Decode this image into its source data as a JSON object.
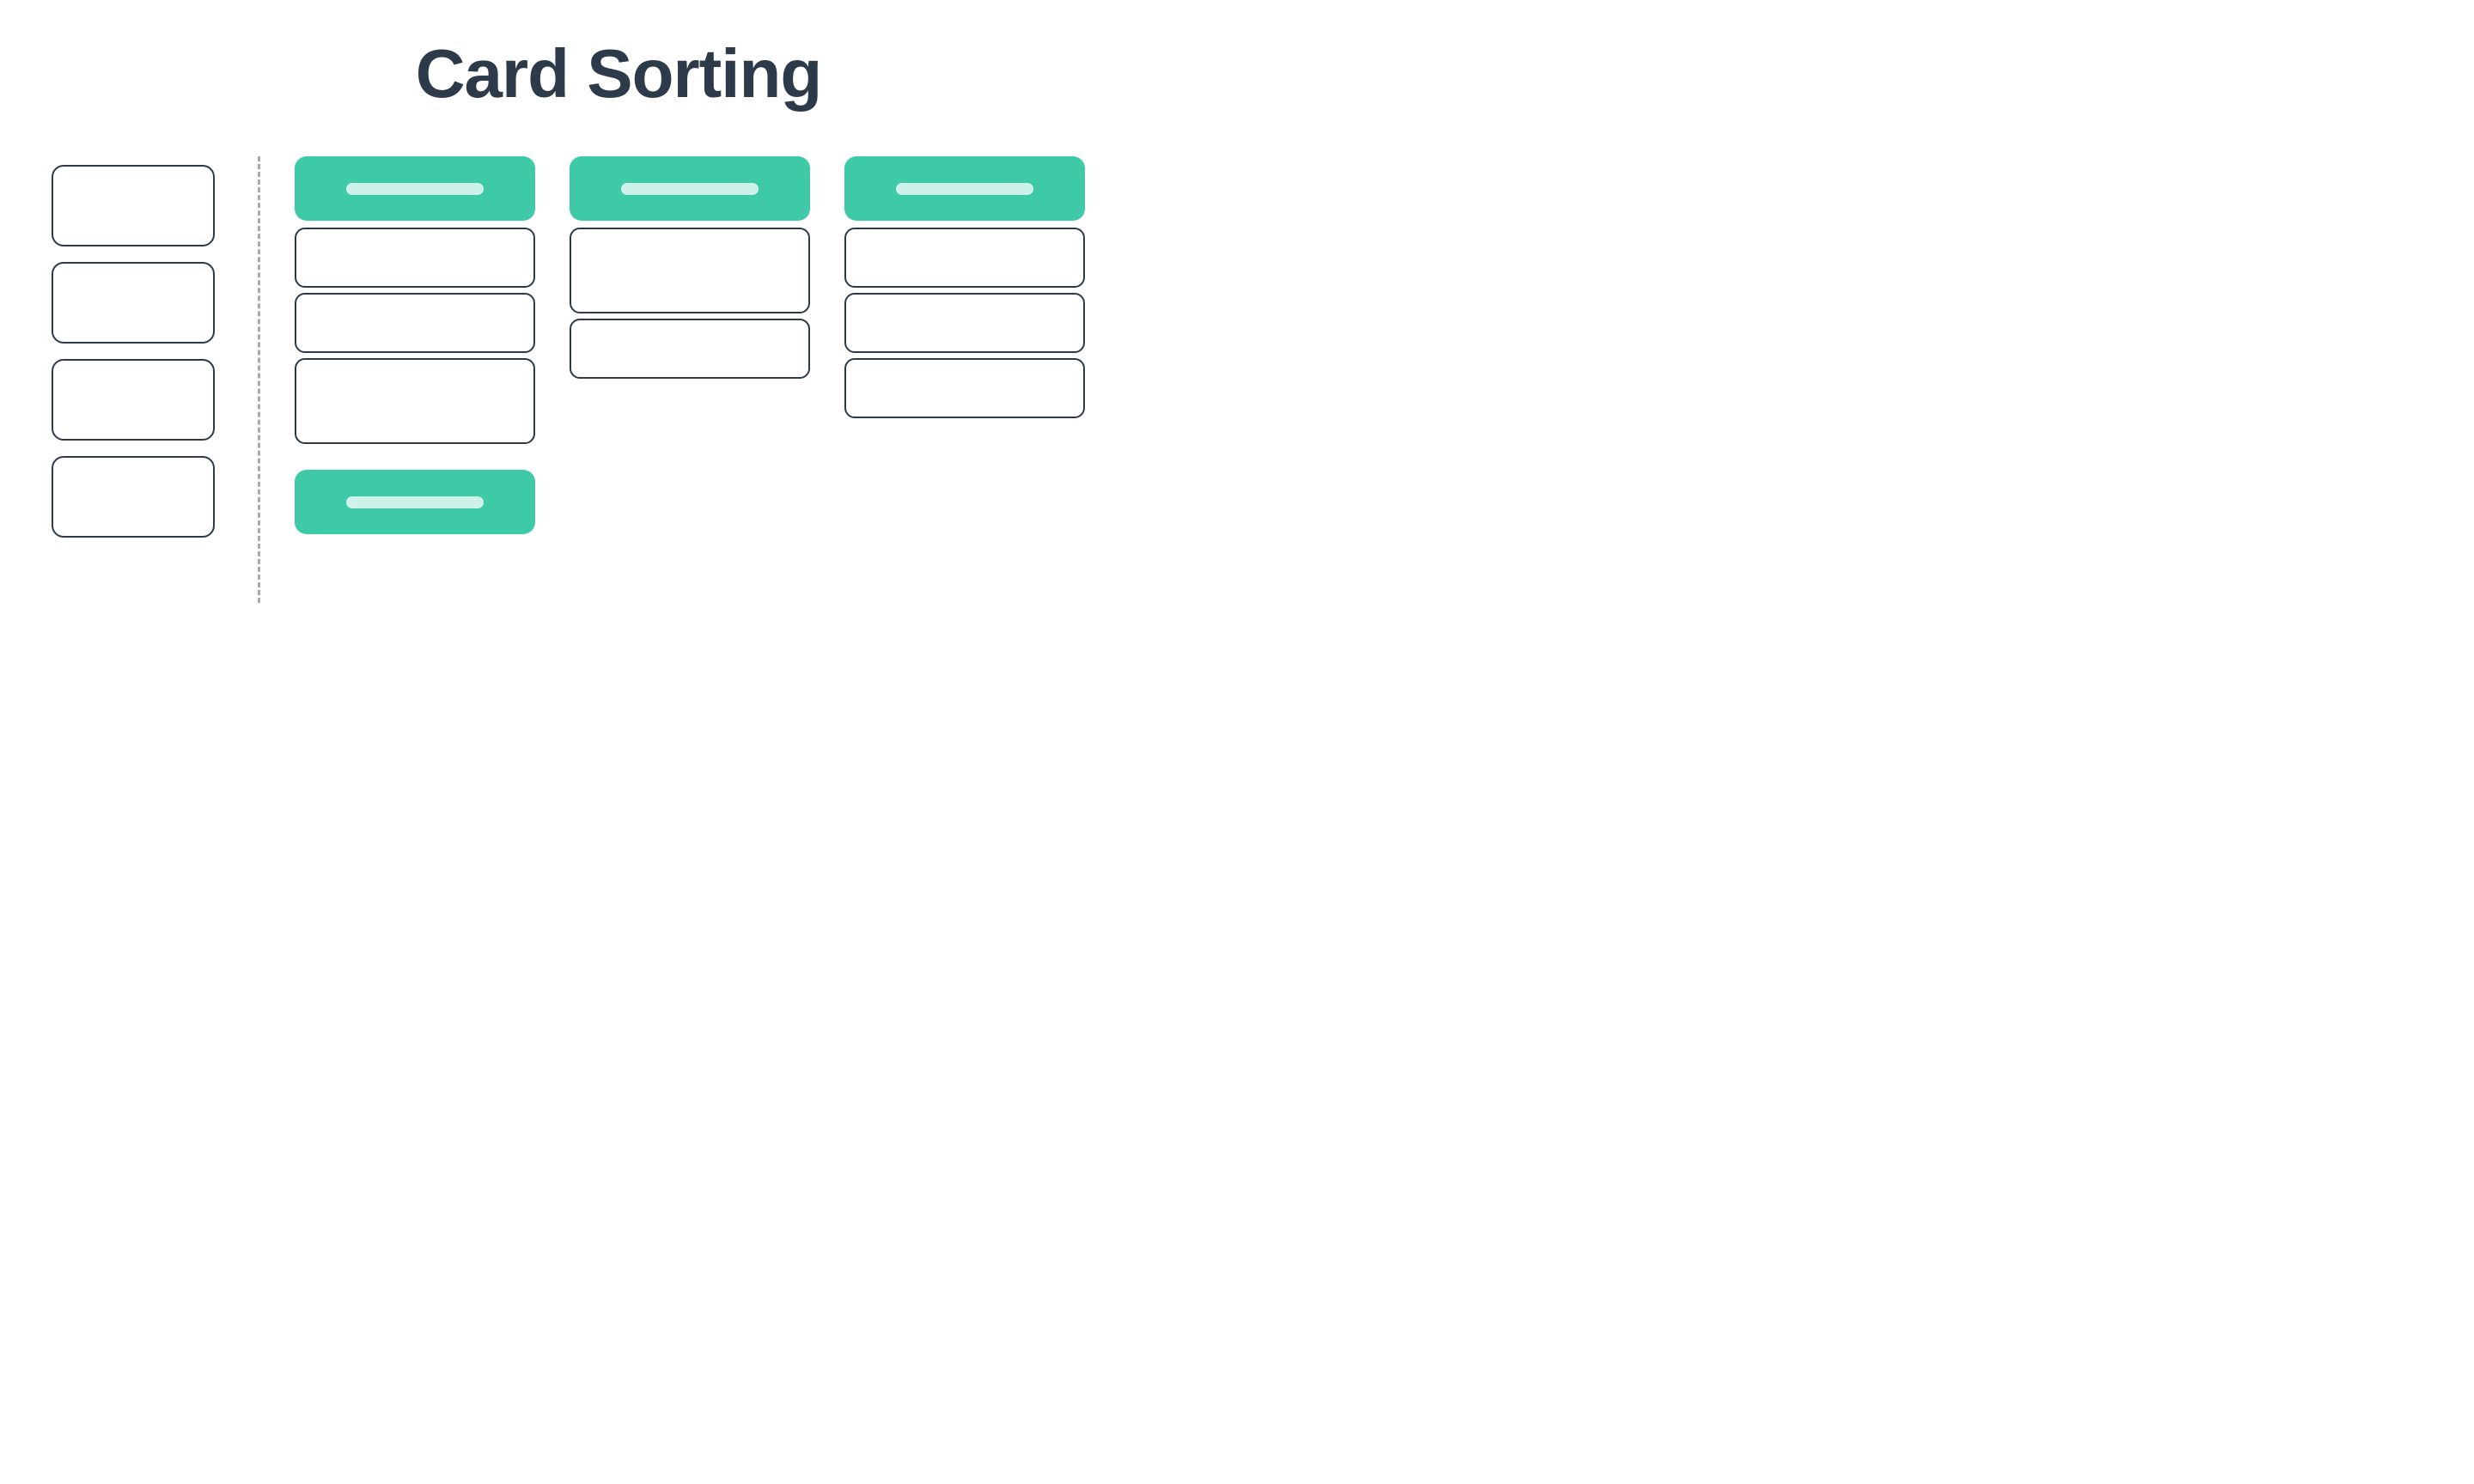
{
  "title": "Card Sorting",
  "colors": {
    "teal": "#3ec9a7",
    "dark": "#2d3a4a",
    "white": "#ffffff",
    "divider": "#aaaaaa"
  },
  "unsorted_cards": [
    {
      "id": "u1"
    },
    {
      "id": "u2"
    },
    {
      "id": "u3"
    },
    {
      "id": "u4"
    }
  ],
  "categories": [
    {
      "id": "cat1",
      "cards": [
        {
          "id": "c1a",
          "tall": false
        },
        {
          "id": "c1b",
          "tall": false
        },
        {
          "id": "c1c",
          "tall": true
        }
      ]
    },
    {
      "id": "cat2",
      "cards": [
        {
          "id": "c2a",
          "tall": true
        },
        {
          "id": "c2b",
          "tall": false
        }
      ]
    },
    {
      "id": "cat3",
      "cards": [
        {
          "id": "c3a",
          "tall": false
        },
        {
          "id": "c3b",
          "tall": false
        },
        {
          "id": "c3c",
          "tall": false
        }
      ]
    }
  ],
  "bottom_category": {
    "id": "cat4"
  }
}
